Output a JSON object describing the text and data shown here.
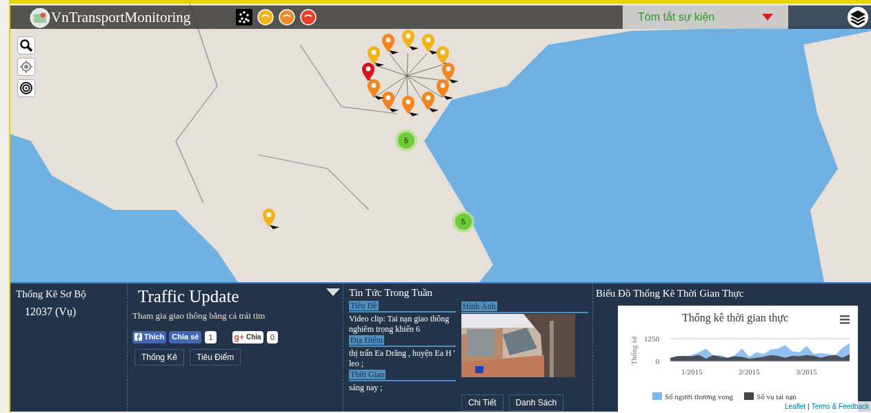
{
  "header": {
    "title": "VnTransportMonitoring",
    "tools": [
      {
        "kind": "cluster"
      },
      {
        "kind": "dot",
        "color": "#f2b41c"
      },
      {
        "kind": "dot",
        "color": "#ef8a2a"
      },
      {
        "kind": "dot",
        "color": "#e8402a"
      }
    ],
    "dropdown": {
      "label": "Tóm tắt sự kiện"
    }
  },
  "map": {
    "pins": [
      {
        "color": "#d7141c"
      },
      {
        "color": "#f2b41c"
      },
      {
        "color": "#f5861f"
      },
      {
        "color": "#f2b41c"
      },
      {
        "color": "#f2b41c"
      },
      {
        "color": "#f2b41c"
      },
      {
        "color": "#f5861f"
      },
      {
        "color": "#f5861f"
      },
      {
        "color": "#f5861f"
      },
      {
        "color": "#f5861f"
      },
      {
        "color": "#f5861f"
      },
      {
        "color": "#f5861f"
      },
      {
        "color": "#f2b41c"
      }
    ],
    "clusters": [
      {
        "count": "5"
      },
      {
        "count": "5"
      }
    ],
    "attribution": {
      "link1": "Leaflet",
      "separator": "|",
      "link2": "Terms & Feedback"
    }
  },
  "panel": {
    "summary": {
      "title": "Thống Kê Sơ Bộ",
      "value": "12037 (Vụ)"
    },
    "update": {
      "title": "Traffic Update",
      "subtitle": "Tham gia giao thông bằng cả trái tim",
      "like": "Thích",
      "share": "Chia sẻ",
      "share_count": "1",
      "gplus_logo": "g+",
      "gplus": "Chia",
      "gplus_count": "0",
      "buttons": [
        "Thống Kê",
        "Tiêu Điểm"
      ]
    },
    "news": {
      "title": "Tin Tức Trong Tuần",
      "fields": [
        {
          "label": "Tiêu Đề",
          "value": "Video clip: Tai nạn giao thông nghiêm trọng khiến 6"
        },
        {
          "label": "Địa Điểm",
          "value": "thị trấn Ea Drăng , huyện Ea H ' leo ;"
        },
        {
          "label": "Thời Gian",
          "value": "sáng nay ;"
        }
      ],
      "image_label": "Hình Ảnh",
      "buttons": [
        "Chi Tiết",
        "Danh Sách"
      ]
    },
    "chart": {
      "heading": "Biểu Đồ Thống Kê Thời Gian Thực",
      "chart_data": {
        "type": "area",
        "title": "Thống kê thời gian thực",
        "ylabel": "Thống kê",
        "categories": [
          null,
          null,
          null,
          "1/2015",
          null,
          null,
          null,
          null,
          null,
          null,
          null,
          "2/2015",
          null,
          null,
          null,
          null,
          null,
          null,
          null,
          "3/2015",
          null,
          null,
          null,
          null,
          null,
          null
        ],
        "ylim": [
          0,
          1250
        ],
        "yticks": [
          0,
          1250
        ],
        "legend": "bottom",
        "series": [
          {
            "name": "Số người thương vong",
            "color": "#7cb5ec",
            "values": [
              200,
              300,
              250,
              350,
              500,
              700,
              300,
              350,
              200,
              350,
              700,
              250,
              500,
              400,
              650,
              700,
              900,
              550,
              500,
              850,
              400,
              450,
              400,
              350,
              750,
              1000
            ]
          },
          {
            "name": "Số vụ tai nạn",
            "color": "#434348",
            "values": [
              200,
              280,
              300,
              280,
              350,
              150,
              350,
              250,
              200,
              280,
              250,
              150,
              200,
              250,
              350,
              300,
              200,
              300,
              280,
              350,
              300,
              200,
              300,
              350,
              200,
              400
            ]
          }
        ]
      }
    }
  }
}
